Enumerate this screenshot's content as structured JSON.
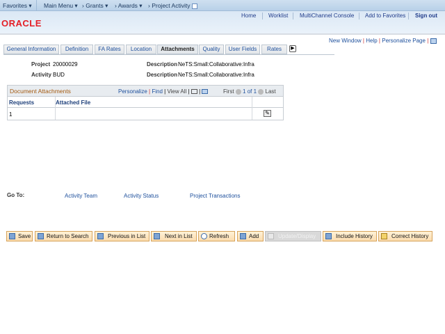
{
  "nav": {
    "favorites": "Favorites",
    "main_menu": "Main Menu",
    "breadcrumbs": [
      "Grants",
      "Awards",
      "Project Activity"
    ]
  },
  "header": {
    "links": [
      "Home",
      "Worklist",
      "MultiChannel Console",
      "Add to Favorites"
    ],
    "sign_out": "Sign out",
    "logo": "ORACLE"
  },
  "page_links": {
    "new_window": "New Window",
    "help": "Help",
    "personalize": "Personalize Page"
  },
  "tabs": [
    {
      "label": "General Information"
    },
    {
      "label": "Definition"
    },
    {
      "label": "FA Rates"
    },
    {
      "label": "Location"
    },
    {
      "label": "Attachments",
      "active": true
    },
    {
      "label": "Quality"
    },
    {
      "label": "User Fields"
    },
    {
      "label": "Rates"
    }
  ],
  "fields": {
    "project_label": "Project",
    "project_value": "20000029",
    "activity_label": "Activity",
    "activity_value": "BUD",
    "desc_label": "Description",
    "desc1": "NeTS:Small:Collaborative:Infra",
    "desc2": "NeTS:Small:Collaborative:Infra"
  },
  "grid": {
    "title": "Document Attachments",
    "personalize": "Personalize",
    "find": "Find",
    "view_all": "View All",
    "first": "First",
    "range": "1 of 1",
    "last": "Last",
    "columns": [
      "Requests",
      "Attached File"
    ],
    "rows": [
      {
        "requests": "1",
        "file": ""
      }
    ]
  },
  "goto": {
    "label": "Go To:",
    "links": [
      "Activity Team",
      "Activity Status",
      "Project Transactions"
    ]
  },
  "buttons": {
    "save": "Save",
    "return": "Return to Search",
    "prev": "Previous in List",
    "next": "Next in List",
    "refresh": "Refresh",
    "add": "Add",
    "update": "Update/Display",
    "include": "Include History",
    "correct": "Correct History"
  }
}
